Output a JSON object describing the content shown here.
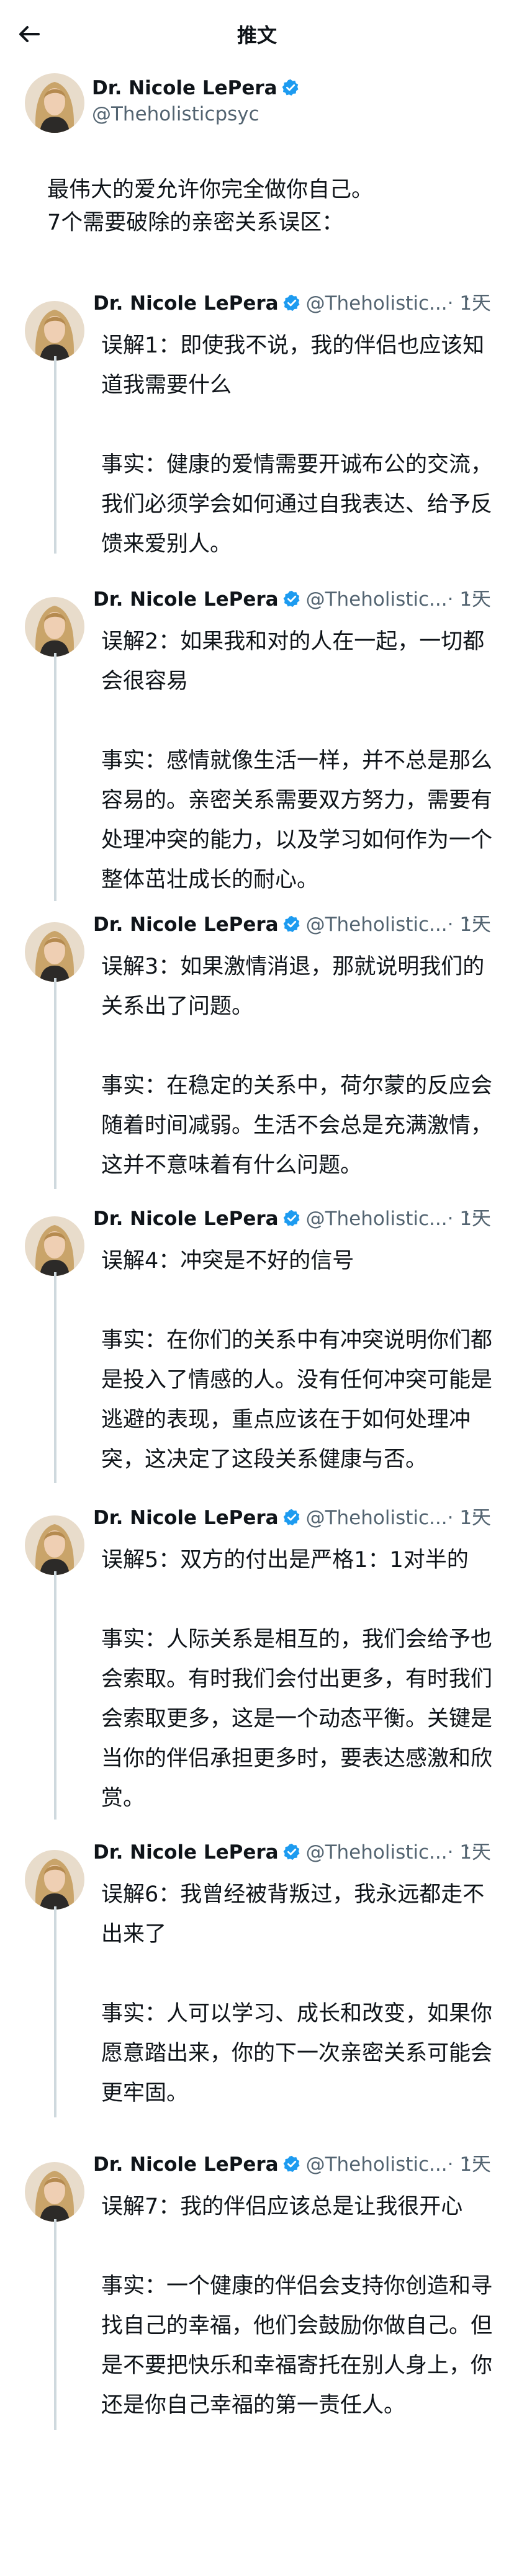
{
  "header": {
    "title": "推文",
    "back_icon": "arrow-left-icon"
  },
  "main_tweet": {
    "author": "Dr. Nicole LePera",
    "handle": "@Theholisticpsyc",
    "lines": [
      "最伟大的爱允许你完全做你自己。",
      "7个需要破除的亲密关系误区："
    ]
  },
  "replies": [
    {
      "author": "Dr. Nicole LePera",
      "handle": "@Theholistic...",
      "time": "· 1天",
      "more": "···",
      "myth": "误解1：即使我不说，我的伴侣也应该知道我需要什么",
      "fact": "事实：健康的爱情需要开诚布公的交流，我们必须学会如何通过自我表达、给予反馈来爱别人。"
    },
    {
      "author": "Dr. Nicole LePera",
      "handle": "@Theholistic...",
      "time": "· 1天",
      "more": "···",
      "myth": "误解2：如果我和对的人在一起，一切都会很容易",
      "fact": "事实：感情就像生活一样，并不总是那么容易的。亲密关系需要双方努力，需要有处理冲突的能力，以及学习如何作为一个整体茁壮成长的耐心。"
    },
    {
      "author": "Dr. Nicole LePera",
      "handle": "@Theholistic...",
      "time": "· 1天",
      "more": "···",
      "myth": "误解3：如果激情消退，那就说明我们的关系出了问题。",
      "fact": "事实：在稳定的关系中，荷尔蒙的反应会随着时间减弱。生活不会总是充满激情，这并不意味着有什么问题。"
    },
    {
      "author": "Dr. Nicole LePera",
      "handle": "@Theholistic...",
      "time": "· 1天",
      "more": "···",
      "myth": "误解4：冲突是不好的信号",
      "fact": "事实：在你们的关系中有冲突说明你们都是投入了情感的人。没有任何冲突可能是逃避的表现，重点应该在于如何处理冲突，这决定了这段关系健康与否。"
    },
    {
      "author": "Dr. Nicole LePera",
      "handle": "@Theholistic...",
      "time": "· 1天",
      "more": "···",
      "myth": "误解5：双方的付出是严格1：1对半的",
      "fact": "事实：人际关系是相互的，我们会给予也会索取。有时我们会付出更多，有时我们会索取更多，这是一个动态平衡。关键是当你的伴侣承担更多时，要表达感激和欣赏。"
    },
    {
      "author": "Dr. Nicole LePera",
      "handle": "@Theholistic...",
      "time": "· 1天",
      "more": "···",
      "myth": "误解6：我曾经被背叛过，我永远都走不出来了",
      "fact": "事实：人可以学习、成长和改变，如果你愿意踏出来，你的下一次亲密关系可能会更牢固。"
    },
    {
      "author": "Dr. Nicole LePera",
      "handle": "@Theholistic...",
      "time": "· 1天",
      "more": "···",
      "myth": "误解7：我的伴侣应该总是让我很开心",
      "fact": "事实：一个健康的伴侣会支持你创造和寻找自己的幸福，他们会鼓励你做自己。但是不要把快乐和幸福寄托在别人身上，你还是你自己幸福的第一责任人。"
    }
  ],
  "colors": {
    "verified": "#1d9bf0",
    "thread_line": "#cfd9de",
    "secondary_text": "#536471"
  }
}
